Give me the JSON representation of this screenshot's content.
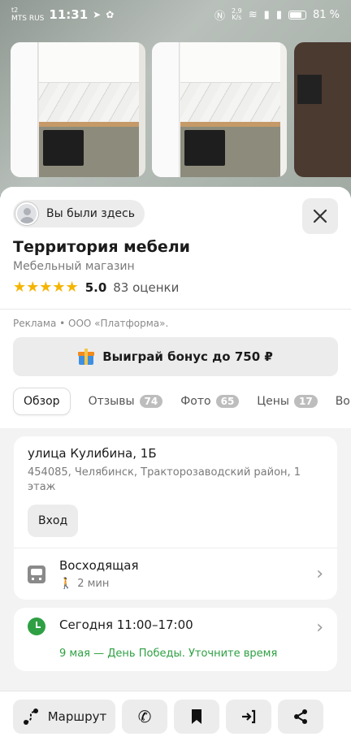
{
  "status_bar": {
    "network": "t2",
    "carrier": "MTS RUS",
    "time": "11:31",
    "speed_value": "2,9",
    "speed_unit": "K/s",
    "battery": "81 %",
    "battery_level": 0.81
  },
  "sheet": {
    "visited_chip": "Вы были здесь",
    "title": "Территория мебели",
    "category": "Мебельный магазин",
    "rating_value": "5.0",
    "rating_count": "83 оценки",
    "ad_text": "Реклама • ООО «Платформа».",
    "bonus_button": "Выиграй бонус до 750 ₽",
    "tabs": [
      {
        "label": "Обзор",
        "count": ""
      },
      {
        "label": "Отзывы",
        "count": "74"
      },
      {
        "label": "Фото",
        "count": "65"
      },
      {
        "label": "Цены",
        "count": "17"
      },
      {
        "label": "Вопр",
        "count": ""
      }
    ]
  },
  "address": {
    "street": "улица Кулибина, 1Б",
    "city_line": "454085, Челябинск, Тракторозаводский район, 1 этаж",
    "entrance_button": "Вход"
  },
  "transit": {
    "stop_name": "Восходящая",
    "walk_time": "2 мин"
  },
  "hours": {
    "today": "Сегодня 11:00–17:00",
    "holiday_note": "9 мая — День Победы. Уточните время"
  },
  "bottom_bar": {
    "route_label": "Маршрут"
  }
}
